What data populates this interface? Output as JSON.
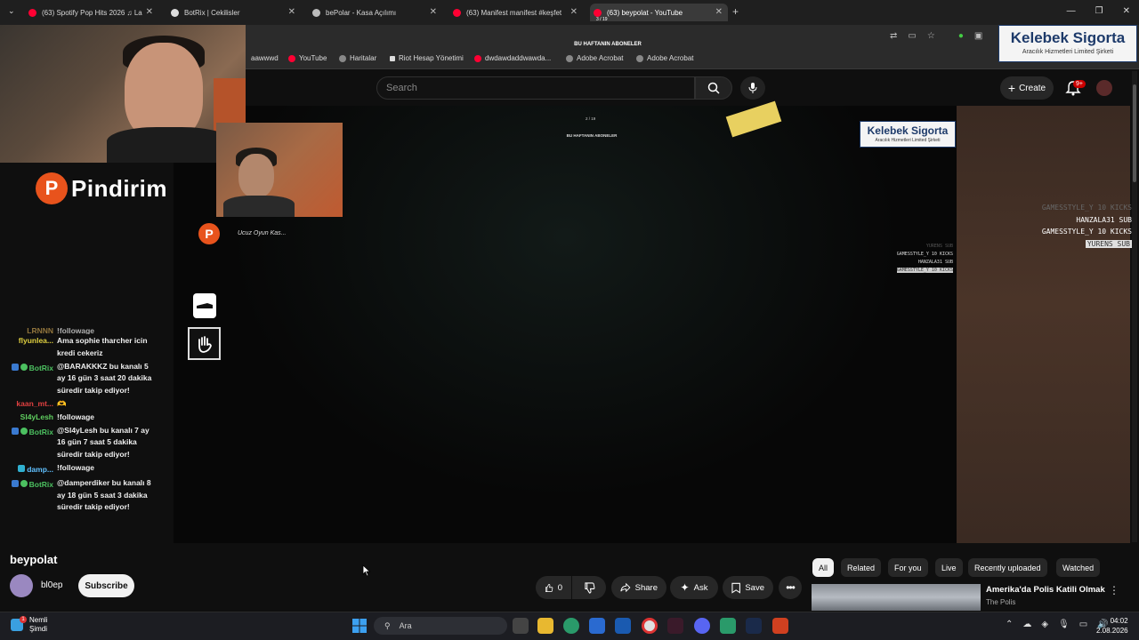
{
  "browser": {
    "tabs": [
      {
        "title": "(63) Spotify Pop Hits 2026 ♫ La",
        "icon_color": "#ff0033"
      },
      {
        "title": "BotRix | Cekilisler",
        "icon_color": "#dddddd"
      },
      {
        "title": "bePolar - Kasa Açılımı",
        "icon_color": "#bbbbbb"
      },
      {
        "title": "(63) Manifest manifest #keşfet",
        "icon_color": "#ff0033"
      },
      {
        "title": "(63) beypolat - YouTube",
        "icon_color": "#ff0033"
      }
    ],
    "bookmarks": [
      {
        "label": "aawwwd",
        "icon": "globe-icon"
      },
      {
        "label": "YouTube",
        "icon": "youtube-icon"
      },
      {
        "label": "Haritalar",
        "icon": "maps-icon"
      },
      {
        "label": "Riot Hesap Yönetimi",
        "icon": "riot-icon"
      },
      {
        "label": "dwdawdaddwawda...",
        "icon": "youtube-icon"
      },
      {
        "label": "Adobe Acrobat",
        "icon": "globe-icon"
      },
      {
        "label": "Adobe Acrobat",
        "icon": "globe-icon"
      }
    ]
  },
  "youtube": {
    "search_placeholder": "Search",
    "create_label": "Create",
    "notif_count": "9+",
    "video_title": "beypolat",
    "channel_name": "bl0ep",
    "subscribe_label": "Subscribe",
    "like_count": "0",
    "share_label": "Share",
    "ask_label": "Ask",
    "save_label": "Save",
    "chips": [
      "All",
      "Related",
      "For you",
      "Live",
      "Recently uploaded",
      "Watched"
    ],
    "recommendation": {
      "title": "Amerika'da Polis Katili Olmak",
      "channel": "The Polis"
    }
  },
  "stream_overlay": {
    "top_label": "BU HAFTANIN ABONELER",
    "top_counter": "3 / 19",
    "inner_label": "BU HAFTANIN ABONELER",
    "inner_counter": "2 / 19",
    "brand": "Pindirim",
    "brand_letter": "P",
    "small_text": "Ucuz Oyun Kas...",
    "sponsor_title": "Kelebek Sigorta",
    "sponsor_sub": "Aracılık Hizmetleri Limited Şirketi",
    "subs_right": [
      {
        "text": "GAMESSTYLE_Y 10 KICKS",
        "style": "faint"
      },
      {
        "text": "HANZALA31 SUB",
        "style": "normal"
      },
      {
        "text": "GAMESSTYLE_Y 10 KICKS",
        "style": "normal"
      },
      {
        "text": "YURENS SUB",
        "style": "hl"
      }
    ],
    "subs_mid": [
      {
        "text": "YURENS SUB",
        "style": "faint"
      },
      {
        "text": "GAMESSTYLE_Y 10 KICKS",
        "style": "normal"
      },
      {
        "text": "HANZALA31 SUB",
        "style": "normal"
      },
      {
        "text": "GAMESSTYLE_Y 10 KICKS",
        "style": "hl"
      }
    ]
  },
  "chat": [
    {
      "user": "LRNNN",
      "color": "#c8a050",
      "text": "!followage",
      "icon": ""
    },
    {
      "user": "flyunlea...",
      "color": "#e0d040",
      "text": "Ama sophie tharcher icin kredi cekeriz",
      "icon": ""
    },
    {
      "user": "BotRix",
      "color": "#4cc060",
      "text": "@BARAKKKZ bu kanalı 5 ay 16 gün 3 saat 20 dakika süredir takip ediyor!",
      "icon": "#3a7ad0"
    },
    {
      "user": "kaan_mt...",
      "color": "#e04040",
      "text": "🫶",
      "icon": ""
    },
    {
      "user": "Sl4yLesh",
      "color": "#60d060",
      "text": "!followage",
      "icon": ""
    },
    {
      "user": "BotRix",
      "color": "#4cc060",
      "text": "@Sl4yLesh bu kanalı 7 ay 16 gün 7 saat 5 dakika süredir takip ediyor!",
      "icon": "#3a7ad0"
    },
    {
      "user": "damp...",
      "color": "#60c0ff",
      "text": "!followage",
      "icon": "#30b0d0"
    },
    {
      "user": "BotRix",
      "color": "#4cc060",
      "text": "@damperdiker bu kanalı 8 ay 18 gün 5 saat 3 dakika süredir takip ediyor!",
      "icon": "#3a7ad0"
    }
  ],
  "taskbar": {
    "notif_title": "Nemli",
    "notif_sub": "Şimdi",
    "notif_badge": "1",
    "search_label": "Ara",
    "time": "04:02",
    "date": "2.08.2026"
  }
}
